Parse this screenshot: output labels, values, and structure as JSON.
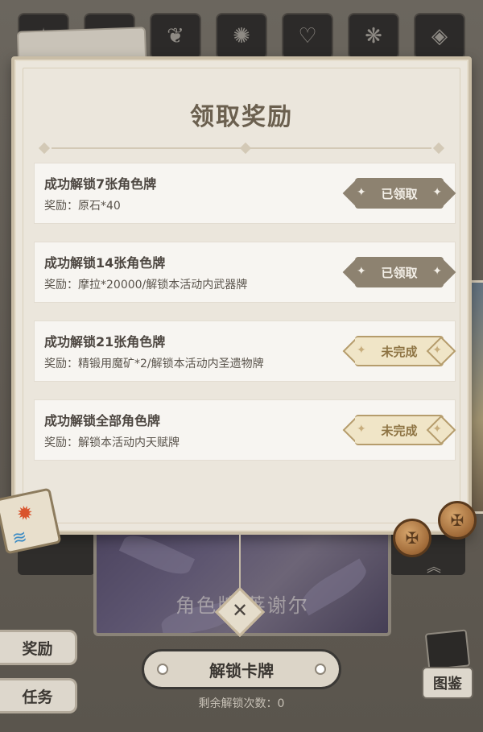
{
  "background": {
    "element_tabs": [
      "pyro-emblem",
      "anemo-emblem",
      "cryo-emblem",
      "hydro-emblem",
      "geo-emblem",
      "dendro-emblem",
      "electro-emblem"
    ],
    "character_card_name": "角色牌·莱谢尔",
    "side_buttons": {
      "rewards": "奖励",
      "tasks": "任务"
    },
    "unlock_button": "解锁卡牌",
    "remaining_label": "剩余解锁次数：0",
    "album_button": "图鉴"
  },
  "modal": {
    "title": "领取奖励",
    "rewards": [
      {
        "title": "成功解锁7张角色牌",
        "desc": "奖励：原石*40",
        "status": "已领取",
        "state": "claimed"
      },
      {
        "title": "成功解锁14张角色牌",
        "desc": "奖励：摩拉*20000/解锁本活动内武器牌",
        "status": "已领取",
        "state": "claimed"
      },
      {
        "title": "成功解锁21张角色牌",
        "desc": "奖励：精锻用魔矿*2/解锁本活动内圣遗物牌",
        "status": "未完成",
        "state": "incomplete"
      },
      {
        "title": "成功解锁全部角色牌",
        "desc": "奖励：解锁本活动内天赋牌",
        "status": "未完成",
        "state": "incomplete"
      }
    ],
    "close_icon": "close-icon"
  },
  "colors": {
    "modal_bg": "#ebe6dc",
    "claimed": "#8d8270",
    "incomplete_fill": "#f0e5c7",
    "incomplete_text": "#8e7444"
  }
}
